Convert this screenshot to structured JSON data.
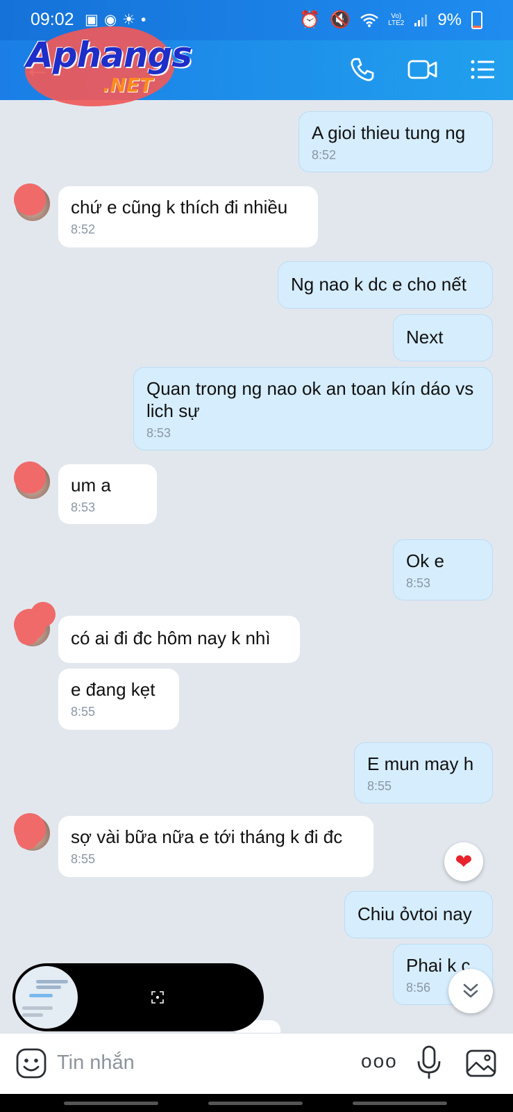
{
  "status_bar": {
    "time": "09:02",
    "left_icons": [
      "image-icon",
      "messenger-icon",
      "weather-icon",
      "dot"
    ],
    "right_icons": [
      "alarm-icon",
      "mute-icon",
      "wifi-icon",
      "lte-icon",
      "signal-icon"
    ],
    "lte_line1": "Vo)",
    "lte_line2": "LTE2",
    "battery": "9%"
  },
  "header": {
    "watermark_title": "Aphangs",
    "watermark_sub": ".NET",
    "icons": [
      "back-arrow-icon",
      "phone-icon",
      "video-call-icon",
      "menu-icon"
    ]
  },
  "messages": [
    {
      "dir": "out",
      "text": "A gioi thieu tung ng",
      "time": "8:52"
    },
    {
      "dir": "in",
      "text": "chứ e cũng k thích đi nhiều",
      "time": "8:52",
      "avatar": true
    },
    {
      "dir": "out",
      "text": "Ng nao k dc e cho nết",
      "time": ""
    },
    {
      "dir": "out",
      "text": "Next",
      "time": ""
    },
    {
      "dir": "out",
      "text": "Quan trong ng nao ok an toan kín dáo vs lich sự",
      "time": "8:53"
    },
    {
      "dir": "in",
      "text": "um a",
      "time": "8:53",
      "avatar": true
    },
    {
      "dir": "out",
      "text": "Ok e",
      "time": "8:53"
    },
    {
      "dir": "in",
      "text": "có ai đi đc hôm nay k nhì",
      "time": "",
      "avatar": true
    },
    {
      "dir": "in",
      "text": "e đang kẹt",
      "time": "8:55"
    },
    {
      "dir": "out",
      "text": "E mun may h",
      "time": "8:55"
    },
    {
      "dir": "in",
      "text": "sợ vài bữa nữa e tới tháng k đi đc",
      "time": "8:55",
      "avatar": true
    },
    {
      "dir": "out",
      "text": "Chiu ỏvtoi nay",
      "time": ""
    },
    {
      "dir": "out",
      "text": "Phai k c",
      "time": "8:56"
    }
  ],
  "reaction": "❤",
  "input_bar": {
    "placeholder": "Tin nhắn",
    "more": "ooo"
  },
  "colors": {
    "header": "#1a7ee6",
    "out_bubble": "#d6edfd",
    "in_bubble": "#ffffff",
    "chat_bg": "#e2e7ee"
  }
}
